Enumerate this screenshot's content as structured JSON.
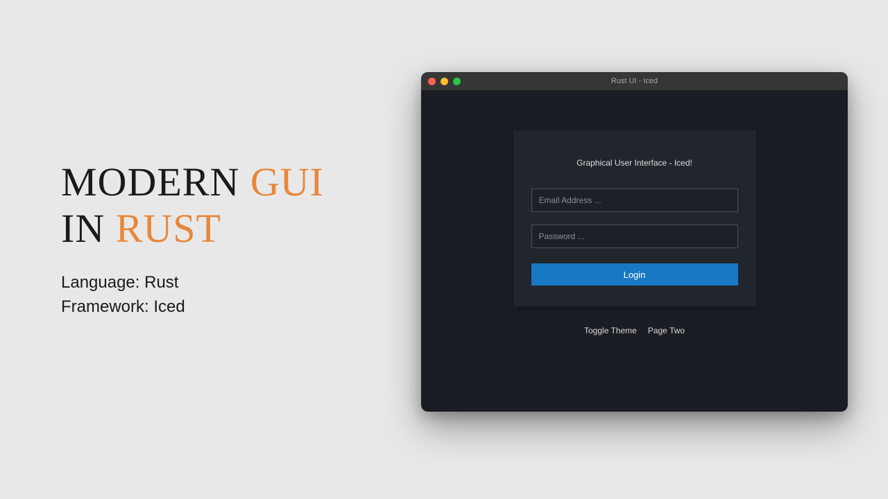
{
  "heading": {
    "line1_part1": "MODERN ",
    "line1_part2": "GUI",
    "line2_part1": "IN ",
    "line2_part2": "RUST"
  },
  "subinfo": {
    "language": "Language: Rust",
    "framework": "Framework: Iced"
  },
  "window": {
    "title": "Rust UI - Iced",
    "card": {
      "heading": "Graphical User Interface - Iced!",
      "email_placeholder": "Email Address ...",
      "password_placeholder": "Password ...",
      "login_label": "Login"
    },
    "links": {
      "toggle_theme": "Toggle Theme",
      "page_two": "Page Two"
    }
  }
}
